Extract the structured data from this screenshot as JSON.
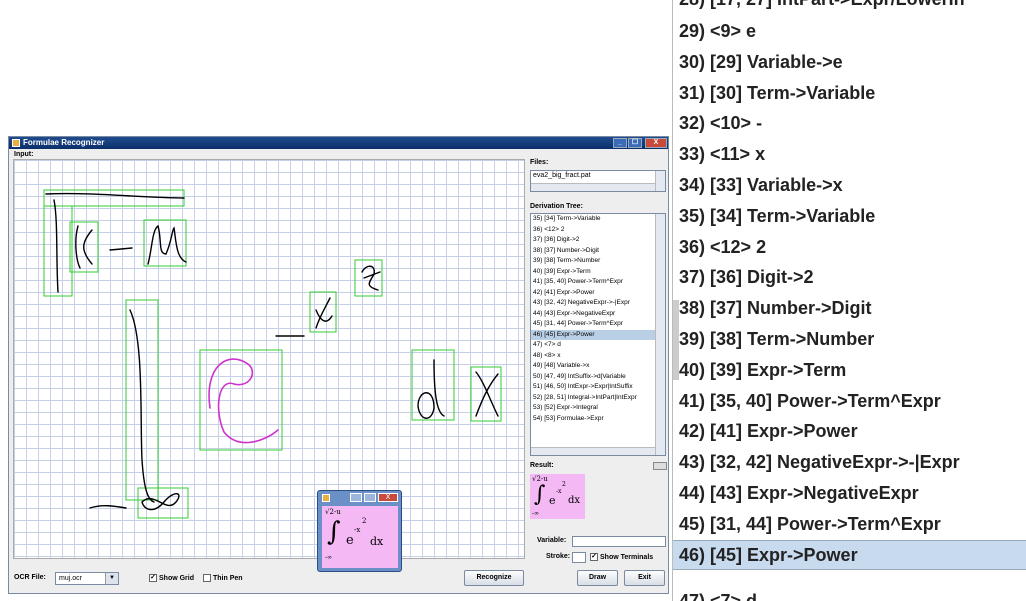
{
  "window": {
    "title": "Formulae Recognizer",
    "input_label": "Input:",
    "files_label": "Files:",
    "derivation_label": "Derivation Tree:",
    "result_label": "Result:",
    "variable_label": "Variable:",
    "stroke_label": "Stroke:",
    "show_terminals_label": "Show Terminals",
    "ocr_file_label": "OCR File:",
    "ocr_file_value": "muj.ocr",
    "show_grid_label": "Show Grid",
    "thin_pen_label": "Thin Pen",
    "recognize_button": "Recognize",
    "draw_button": "Draw",
    "exit_button": "Exit",
    "minimize": "_",
    "maximize": "☐",
    "close": "X"
  },
  "files": {
    "items": [
      "eva2_big_fract.pat"
    ]
  },
  "derivation_tree": {
    "rows": [
      "35) [34] Term->Variable",
      "36) <12> 2",
      "37) [36] Digit->2",
      "38) [37] Number->Digit",
      "39) [38] Term->Number",
      "40) [39] Expr->Term",
      "41) [35, 40] Power->Term^Expr",
      "42) [41] Expr->Power",
      "43) [32, 42] NegativeExpr->-|Expr",
      "44) [43] Expr->NegativeExpr",
      "45) [31, 44] Power->Term^Expr",
      "46) [45] Expr->Power",
      "47) <7> d",
      "48) <8> x",
      "49) [48] Variable->x",
      "50) [47, 49] IntSuffix->d|Variable",
      "51) [46, 50] IntExpr->Expr|IntSuffix",
      "52) [28, 51] Integral->IntPart|IntExpr",
      "53) [52] Expr->Integral",
      "54) [53] Formulae->Expr"
    ],
    "selected_index": 11
  },
  "result": {
    "upper": "√2-u",
    "lower": "-∞",
    "base": "e",
    "exponent": "2",
    "neg_x": "-x",
    "dx": "dx"
  },
  "popup": {
    "upper": "√2-u",
    "lower": "-∞",
    "base": "e",
    "exponent": "2",
    "neg_x": "-x",
    "dx": "dx"
  },
  "zoom_panel": {
    "top_partial": "28) [17, 27] IntPart->Expr/LowerIn",
    "rows": [
      "29) <9> e",
      "30) [29] Variable->e",
      "31) [30] Term->Variable",
      "32) <10> -",
      "33) <11> x",
      "34) [33] Variable->x",
      "35) [34] Term->Variable",
      "36) <12> 2",
      "37) [36] Digit->2",
      "38) [37] Number->Digit",
      "39) [38] Term->Number",
      "40) [39] Expr->Term",
      "41) [35, 40] Power->Term^Expr",
      "42) [41] Expr->Power",
      "43) [32, 42] NegativeExpr->-|Expr",
      "44) [43] Expr->NegativeExpr",
      "45) [31, 44] Power->Term^Expr",
      "46) [45] Expr->Power"
    ],
    "selected_index": 17,
    "bottom_partial": "47) <7> d"
  },
  "colors": {
    "ink": "#000000",
    "ink_alt": "#cc33cc",
    "box": "#33cc33",
    "result_bg": "#f4b8f4",
    "selection": "#b8cfe6"
  }
}
